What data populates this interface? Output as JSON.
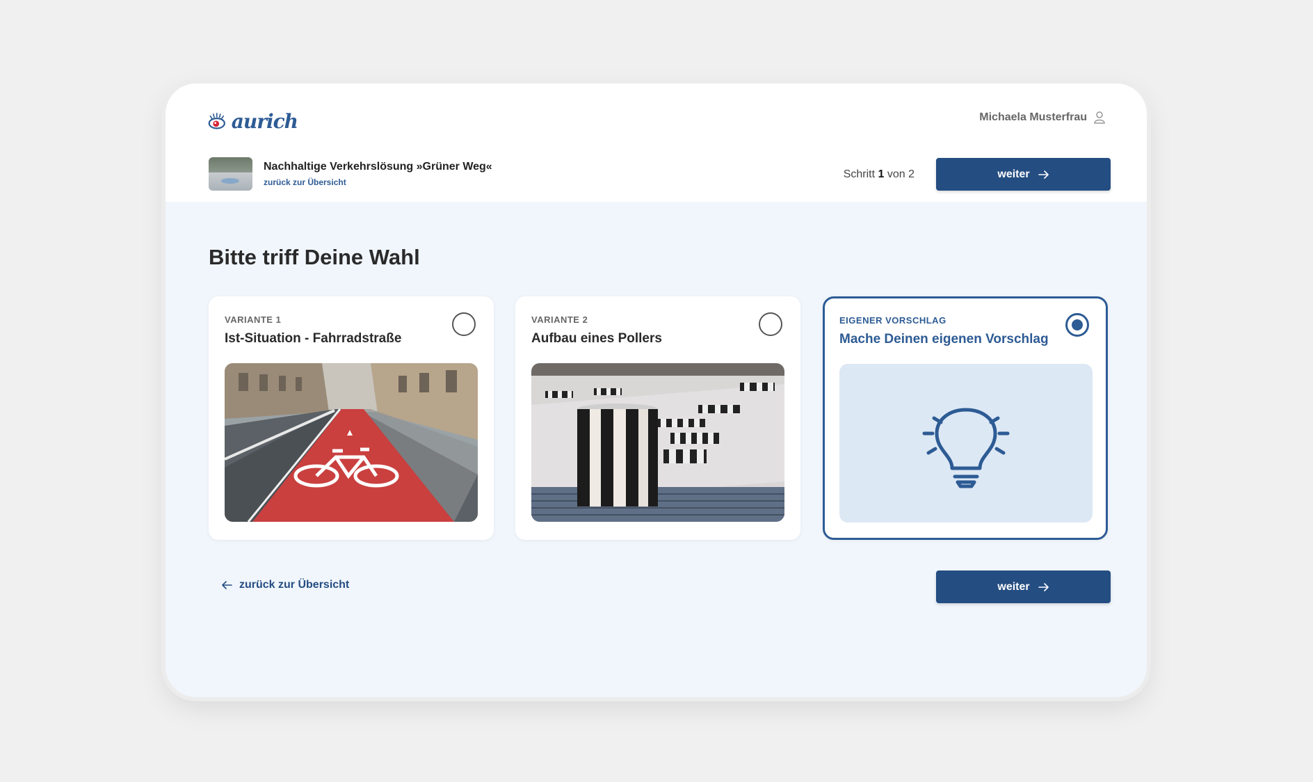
{
  "header": {
    "logo_text": "aurich",
    "user_name": "Michaela Musterfrau"
  },
  "project": {
    "title": "Nachhaltige Verkehrslösung »Grüner Weg«",
    "back_link": "zurück zur Übersicht"
  },
  "step": {
    "prefix": "Schritt",
    "current": "1",
    "middle": "von",
    "total": "2"
  },
  "buttons": {
    "next_label": "weiter"
  },
  "main": {
    "title": "Bitte triff Deine Wahl",
    "back_link": "zurück zur Übersicht"
  },
  "options": [
    {
      "tag": "VARIANTE 1",
      "title": "Ist-Situation - Fahrradstraße",
      "selected": false,
      "image": "bike-lane-photo"
    },
    {
      "tag": "VARIANTE 2",
      "title": "Aufbau eines Pollers",
      "selected": false,
      "image": "bollards-photo"
    },
    {
      "tag": "EIGENER VORSCHLAG",
      "title": "Mache Deinen eigenen Vorschlag",
      "selected": true,
      "image": "lightbulb-icon"
    }
  ],
  "colors": {
    "primary": "#244d82",
    "accent_blue": "#2d5b94",
    "page_bg": "#f1f6fc",
    "bike_lane_red": "#c9403f"
  }
}
